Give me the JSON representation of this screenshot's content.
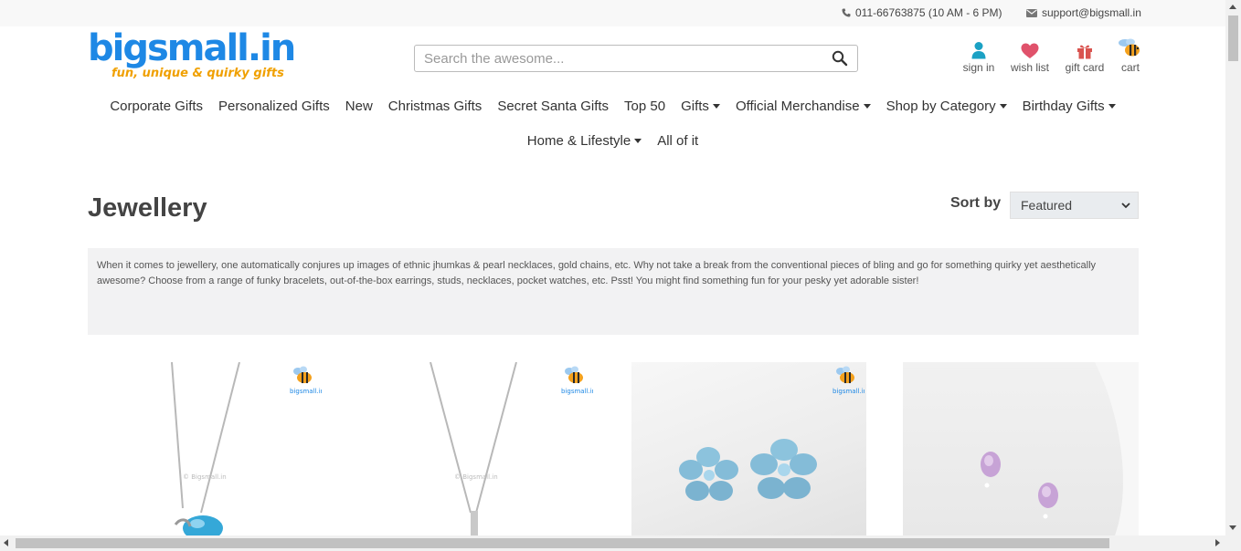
{
  "topbar": {
    "phone": "011-66763875 (10 AM - 6 PM)",
    "email": "support@bigsmall.in"
  },
  "logo": {
    "wordmark": "bigsmall.in",
    "tagline": "fun, unique & quirky gifts"
  },
  "search": {
    "placeholder": "Search the awesome...",
    "value": ""
  },
  "account": {
    "sign_in": "sign in",
    "wish_list": "wish list",
    "gift_card": "gift card",
    "cart": "cart"
  },
  "nav": {
    "row1": [
      {
        "label": "Corporate Gifts",
        "dropdown": false
      },
      {
        "label": "Personalized Gifts",
        "dropdown": false
      },
      {
        "label": "New",
        "dropdown": false
      },
      {
        "label": "Christmas Gifts",
        "dropdown": false
      },
      {
        "label": "Secret Santa Gifts",
        "dropdown": false
      },
      {
        "label": "Top 50",
        "dropdown": false
      },
      {
        "label": "Gifts",
        "dropdown": true
      },
      {
        "label": "Official Merchandise",
        "dropdown": true
      },
      {
        "label": "Shop by Category",
        "dropdown": true
      },
      {
        "label": "Birthday Gifts",
        "dropdown": true
      }
    ],
    "row2": [
      {
        "label": "Home & Lifestyle",
        "dropdown": true
      },
      {
        "label": "All of it",
        "dropdown": false
      }
    ]
  },
  "page": {
    "title": "Jewellery",
    "sort_label": "Sort by",
    "sort_selected": "Featured",
    "description": "When it comes to jewellery, one automatically conjures up images of ethnic jhumkas & pearl necklaces, gold chains, etc. Why not take a break from the conventional pieces of bling and go for something quirky yet aesthetically awesome? Choose from a range of funky bracelets, out-of-the-box earrings, studs, necklaces, pocket watches, etc. Psst! You might find something fun for your pesky yet adorable sister!"
  },
  "products": {
    "watermark": "© Bigsmall.in",
    "badge_text": "bigsmall.in"
  },
  "colors": {
    "brand_blue": "#1e88e5",
    "brand_orange": "#f0a000",
    "account_icon_blue": "#1ba1c4",
    "wishlist_heart": "#e0526b",
    "giftcard_red": "#d9534f"
  }
}
